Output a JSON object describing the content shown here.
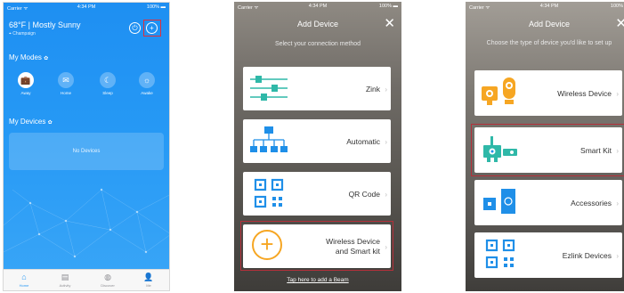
{
  "colors": {
    "brand_blue": "#2a9af5",
    "orange": "#f6a623",
    "blue_icon": "#1f8fe8",
    "red_highlight": "#b5303a"
  },
  "status": {
    "carrier": "Carrier ᯤ",
    "time": "4:34 PM",
    "battery": "100% ▬"
  },
  "home": {
    "weather": "68°F | Mostly Sunny",
    "location": "Champaign",
    "modes_title": "My Modes",
    "modes": [
      {
        "label": "Away",
        "icon": "briefcase-icon",
        "glyph": "💼"
      },
      {
        "label": "Home",
        "icon": "mail-icon",
        "glyph": "✉"
      },
      {
        "label": "Sleep",
        "icon": "moon-icon",
        "glyph": "☾"
      },
      {
        "label": "Awake",
        "icon": "sun-icon",
        "glyph": "☼"
      }
    ],
    "devices_title": "My Devices",
    "no_devices": "No Devices",
    "tabs": [
      {
        "label": "Home",
        "glyph": "⌂"
      },
      {
        "label": "Activity",
        "glyph": "▤"
      },
      {
        "label": "Discover",
        "glyph": "◍"
      },
      {
        "label": "Me",
        "glyph": "👤"
      }
    ]
  },
  "add_device_method": {
    "title": "Add Device",
    "subtitle": "Select your connection method",
    "options": [
      {
        "label": "Zink",
        "icon": "zink-sliders-icon"
      },
      {
        "label": "Automatic",
        "icon": "automatic-tree-icon"
      },
      {
        "label": "QR Code",
        "icon": "qr-code-icon"
      },
      {
        "label": "Wireless Device and Smart kit",
        "icon": "plus-circle-icon"
      }
    ],
    "beam_link": "Tap here to add a Beam"
  },
  "add_device_type": {
    "title": "Add Device",
    "subtitle": "Choose the type of device you'd like to set up",
    "options": [
      {
        "label": "Wireless Device",
        "icon": "wireless-camera-icon"
      },
      {
        "label": "Smart Kit",
        "icon": "smart-kit-icon"
      },
      {
        "label": "Accessories",
        "icon": "accessories-icon"
      },
      {
        "label": "Ezlink Devices",
        "icon": "ezlink-qr-icon"
      }
    ]
  }
}
